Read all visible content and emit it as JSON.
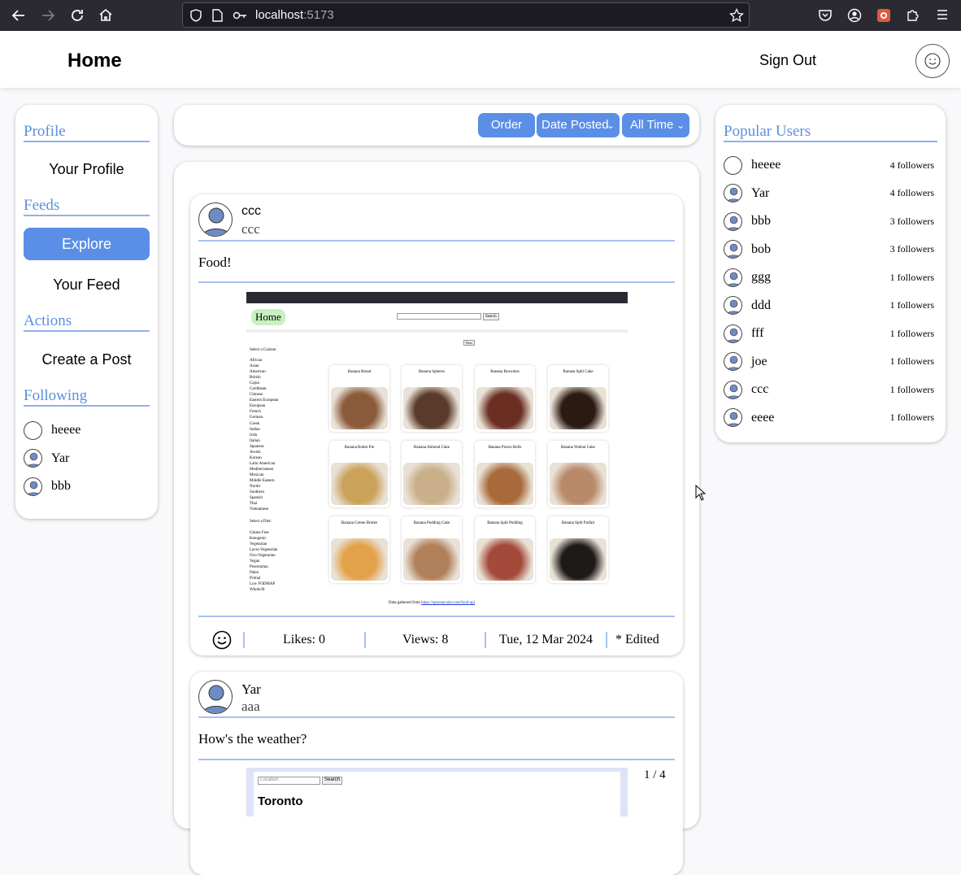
{
  "browser": {
    "url_host": "localhost",
    "url_port": ":5173"
  },
  "header": {
    "title": "Home",
    "sign_out": "Sign Out"
  },
  "left_nav": {
    "profile_title": "Profile",
    "your_profile": "Your Profile",
    "feeds_title": "Feeds",
    "explore": "Explore",
    "your_feed": "Your Feed",
    "actions_title": "Actions",
    "create_post": "Create a Post",
    "following_title": "Following",
    "following": [
      {
        "name": "heeee"
      },
      {
        "name": "Yar"
      },
      {
        "name": "bbb"
      }
    ]
  },
  "toolbar": {
    "order": "Order",
    "sort_by": "Date Posted",
    "time_range": "All Time"
  },
  "posts": [
    {
      "author": "ccc",
      "handle": "ccc",
      "text": "Food!",
      "likes": "Likes: 0",
      "views": "Views: 8",
      "date": "Tue, 12 Mar 2024",
      "edited": "* Edited",
      "image": {
        "home": "Home",
        "search_btn": "Search",
        "next_btn": "Next",
        "cuisine_title": "Select a Cuisine:",
        "cuisines": [
          "African",
          "Asian",
          "American",
          "British",
          "Cajun",
          "Caribbean",
          "Chinese",
          "Eastern European",
          "European",
          "French",
          "German",
          "Greek",
          "Indian",
          "Irish",
          "Italian",
          "Japanese",
          "Jewish",
          "Korean",
          "Latin American",
          "Mediterranean",
          "Mexican",
          "Middle Eastern",
          "Nordic",
          "Southern",
          "Spanish",
          "Thai",
          "Vietnamese"
        ],
        "diet_title": "Select a Diet:",
        "diets": [
          "Gluten Free",
          "Ketogenic",
          "Vegetarian",
          "Lacto-Vegetarian",
          "Ovo-Vegetarian",
          "Vegan",
          "Pescetarian",
          "Paleo",
          "Primal",
          "Low FODMAP",
          "Whole30"
        ],
        "foods": [
          "Banana Bread",
          "Banana Spheres",
          "Banana Brownies",
          "Banana Split Cake",
          "Banana Butter Pie",
          "Banana Almond Cake",
          "Banana Prawn Rolls",
          "Banana Walnut Cake",
          "Banana Creme Brulee",
          "Banana Pudding Cake",
          "Banana Split Pudding",
          "Banana Split Parfait"
        ],
        "footer_text": "Data gathered from",
        "footer_link": "https://spoonacular.com/food-api"
      }
    },
    {
      "author": "Yar",
      "handle": "aaa",
      "text": "How's the weather?",
      "counter": "1 / 4",
      "image": {
        "location_placeholder": "Location",
        "search_btn": "Search",
        "city": "Toronto"
      }
    }
  ],
  "popular": {
    "title": "Popular Users",
    "users": [
      {
        "name": "heeee",
        "followers": "4 followers",
        "blank": true
      },
      {
        "name": "Yar",
        "followers": "4 followers"
      },
      {
        "name": "bbb",
        "followers": "3 followers"
      },
      {
        "name": "bob",
        "followers": "3 followers"
      },
      {
        "name": "ggg",
        "followers": "1 followers"
      },
      {
        "name": "ddd",
        "followers": "1 followers"
      },
      {
        "name": "fff",
        "followers": "1 followers"
      },
      {
        "name": "joe",
        "followers": "1 followers"
      },
      {
        "name": "ccc",
        "followers": "1 followers"
      },
      {
        "name": "eeee",
        "followers": "1 followers"
      }
    ]
  },
  "colors": {
    "accent": "#5b8ee6",
    "section_title": "#5b8fd9",
    "divider": "#a9c1f0"
  }
}
